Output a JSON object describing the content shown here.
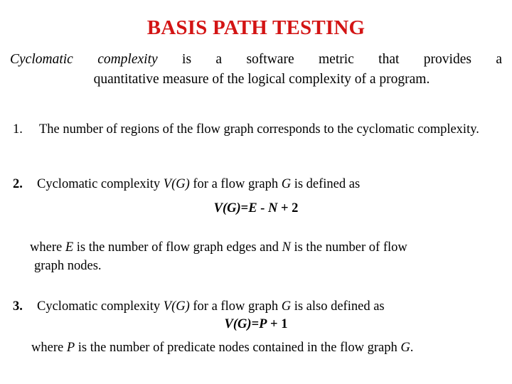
{
  "slide": {
    "title": "BASIS PATH TESTING",
    "title_color": "#d31414",
    "background_color": "#ffffff",
    "text_color": "#000000"
  },
  "intro": {
    "lead_italic": "Cyclomatic complexity",
    "line1_rest": " is a software metric that provides a",
    "line2": "quantitative measure of the logical complexity of a program."
  },
  "items": [
    {
      "marker": "1.",
      "marker_bold": false,
      "text": "The number of regions of the flow graph corresponds to the cyclomatic complexity."
    },
    {
      "marker": "2.",
      "marker_bold": true,
      "text_part1": "Cyclomatic complexity ",
      "var1": "V(G)",
      "text_part2": " for a flow graph ",
      "var2": "G",
      "text_part3": " is defined as"
    },
    {
      "marker": "3.",
      "marker_bold": true,
      "text_part1": "Cyclomatic complexity ",
      "var1": "V(G)",
      "text_part2": " for a flow graph ",
      "var2": "G",
      "text_part3": " is also defined as"
    }
  ],
  "formulas": {
    "formula1": {
      "lhs": "V(G)",
      "eq": "=",
      "rhs_var1": "E",
      "op1": " - ",
      "rhs_var2": "N",
      "op2": " + ",
      "constant": "2",
      "full": "V(G)=E - N + 2"
    },
    "formula2": {
      "lhs": "V(G)",
      "eq": "=",
      "rhs_var1": "P",
      "op2": " + ",
      "constant": "1",
      "full": "V(G)=P + 1"
    }
  },
  "where_clauses": {
    "where1": {
      "pre": "where ",
      "var1": "E",
      "mid": " is the number of flow graph edges and ",
      "var2": "N",
      "post": " is the number of flow",
      "line2": "graph nodes."
    },
    "where2": {
      "pre": "where ",
      "var1": "P",
      "mid": " is the number of predicate nodes contained in the flow graph ",
      "var2": "G",
      "post": "."
    }
  }
}
